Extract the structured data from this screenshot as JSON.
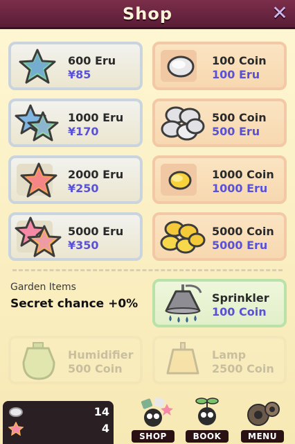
{
  "header": {
    "title": "Shop"
  },
  "eru_items": [
    {
      "name": "600 Eru",
      "price": "¥85"
    },
    {
      "name": "1000 Eru",
      "price": "¥170"
    },
    {
      "name": "2000 Eru",
      "price": "¥250"
    },
    {
      "name": "5000 Eru",
      "price": "¥350"
    }
  ],
  "coin_items": [
    {
      "name": "100 Coin",
      "price": "100 Eru"
    },
    {
      "name": "500 Coin",
      "price": "500 Eru"
    },
    {
      "name": "1000 Coin",
      "price": "1000 Eru"
    },
    {
      "name": "5000 Coin",
      "price": "5000 Eru"
    }
  ],
  "garden": {
    "label": "Garden Items",
    "secret_chance": "Secret chance +0%"
  },
  "garden_items": [
    {
      "name": "Sprinkler",
      "price": "100 Coin",
      "locked": false
    },
    {
      "name": "Humidifier",
      "price": "500 Coin",
      "locked": true
    },
    {
      "name": "Lamp",
      "price": "2500 Coin",
      "locked": true
    }
  ],
  "counters": {
    "coins": "14",
    "stars": "4"
  },
  "nav": {
    "shop": "SHOP",
    "book": "BOOK",
    "menu": "MENU"
  },
  "colors": {
    "price": "#5a52d4",
    "header": "#7b2e4a"
  }
}
